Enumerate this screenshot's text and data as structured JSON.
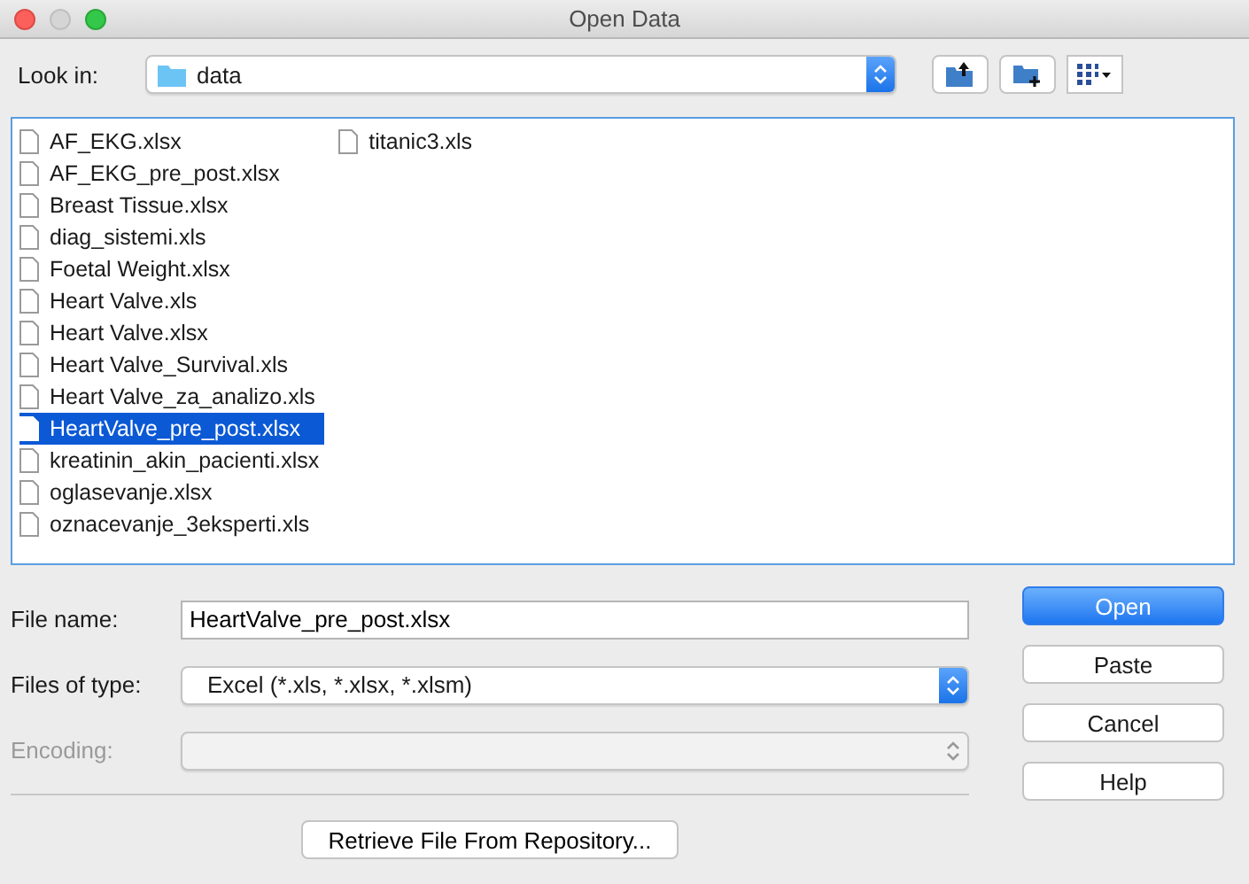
{
  "window": {
    "title": "Open Data"
  },
  "look_in": {
    "label": "Look in:",
    "value": "data"
  },
  "files": [
    {
      "name": "AF_EKG.xlsx",
      "selected": false
    },
    {
      "name": "AF_EKG_pre_post.xlsx",
      "selected": false
    },
    {
      "name": "Breast Tissue.xlsx",
      "selected": false
    },
    {
      "name": "diag_sistemi.xls",
      "selected": false
    },
    {
      "name": "Foetal Weight.xlsx",
      "selected": false
    },
    {
      "name": "Heart Valve.xls",
      "selected": false
    },
    {
      "name": "Heart Valve.xlsx",
      "selected": false
    },
    {
      "name": "Heart Valve_Survival.xls",
      "selected": false
    },
    {
      "name": "Heart Valve_za_analizo.xls",
      "selected": false
    },
    {
      "name": "HeartValve_pre_post.xlsx",
      "selected": true
    },
    {
      "name": "kreatinin_akin_pacienti.xlsx",
      "selected": false
    },
    {
      "name": "oglasevanje.xlsx",
      "selected": false
    },
    {
      "name": "oznacevanje_3eksperti.xls",
      "selected": false
    },
    {
      "name": "titanic3.xls",
      "selected": false
    }
  ],
  "file_name": {
    "label": "File name:",
    "value": "HeartValve_pre_post.xlsx"
  },
  "files_of_type": {
    "label": "Files of type:",
    "value": "Excel (*.xls, *.xlsx, *.xlsm)",
    "disabled": false
  },
  "encoding": {
    "label": "Encoding:",
    "disabled": true
  },
  "buttons": [
    {
      "label": "Open",
      "primary": true
    },
    {
      "label": "Paste",
      "primary": false
    },
    {
      "label": "Cancel",
      "primary": false
    },
    {
      "label": "Help",
      "primary": false
    }
  ],
  "repository_button": "Retrieve File From Repository..."
}
